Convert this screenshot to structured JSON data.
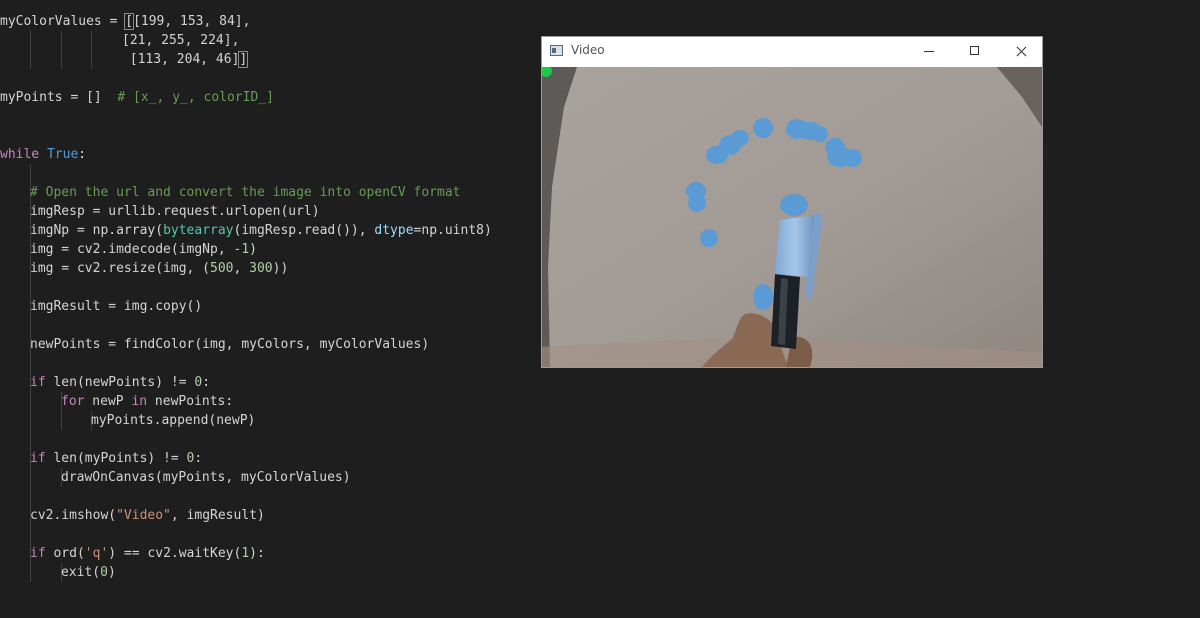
{
  "editor": {
    "lines": {
      "l1": {
        "a": "myColorValues = ",
        "b": "[",
        "c": "[199, 153, 84],"
      },
      "l2": {
        "a": "[21, 255, 224],"
      },
      "l3": {
        "a": " [113, 204, 46]",
        "b": "]"
      },
      "l5": {
        "a": "myPoints = []  ",
        "b": "# [x_, y_, colorID_]"
      },
      "l8": {
        "kw": "while",
        "sp": " ",
        "val": "True",
        "colon": ":"
      },
      "l10": {
        "a": "# Open the url and convert the image into openCV format"
      },
      "l11": {
        "a": "imgResp = urllib.request.urlopen(url)"
      },
      "l12": {
        "a": "imgNp = np.array(",
        "b": "bytearray",
        "c": "(imgResp.read()), ",
        "d": "dtype",
        "e": "=np.uint8)"
      },
      "l13": {
        "a": "img = cv2.imdecode(imgNp, ",
        "b": "-1",
        "c": ")"
      },
      "l14": {
        "a": "img = cv2.resize(img, (",
        "b": "500",
        "c": ", ",
        "d": "300",
        "e": "))"
      },
      "l16": {
        "a": "imgResult = img.copy()"
      },
      "l18": {
        "a": "newPoints = findColor(img, myColors, myColorValues)"
      },
      "l20": {
        "kw": "if",
        "a": " len(newPoints) != ",
        "b": "0",
        "c": ":"
      },
      "l21": {
        "kw": "for",
        "a": " newP ",
        "kw2": "in",
        "b": " newPoints:"
      },
      "l22": {
        "a": "myPoints.append(newP)"
      },
      "l24": {
        "kw": "if",
        "a": " len(myPoints) != ",
        "b": "0",
        "c": ":"
      },
      "l25": {
        "a": "drawOnCanvas(myPoints, myColorValues)"
      },
      "l27": {
        "a": "cv2.imshow(",
        "b": "\"Video\"",
        "c": ", imgResult)"
      },
      "l29": {
        "kw": "if",
        "a": " ord(",
        "b": "'q'",
        "c": ") == cv2.waitKey(",
        "d": "1",
        "e": "):"
      },
      "l30": {
        "a": "exit(",
        "b": "0",
        "c": ")"
      }
    }
  },
  "video_window": {
    "title": "Video",
    "icon": "window-app-icon",
    "controls": [
      "minimize-icon",
      "maximize-icon",
      "close-icon"
    ],
    "stroke_color": "#5b9bd5",
    "corner_dot_color": "#21c94a"
  },
  "colors": {
    "background": "#1e1e1e",
    "keyword": "#c586c0",
    "constant": "#569cd6",
    "string": "#ce9178",
    "number": "#b5cea8",
    "comment": "#6a9955"
  }
}
